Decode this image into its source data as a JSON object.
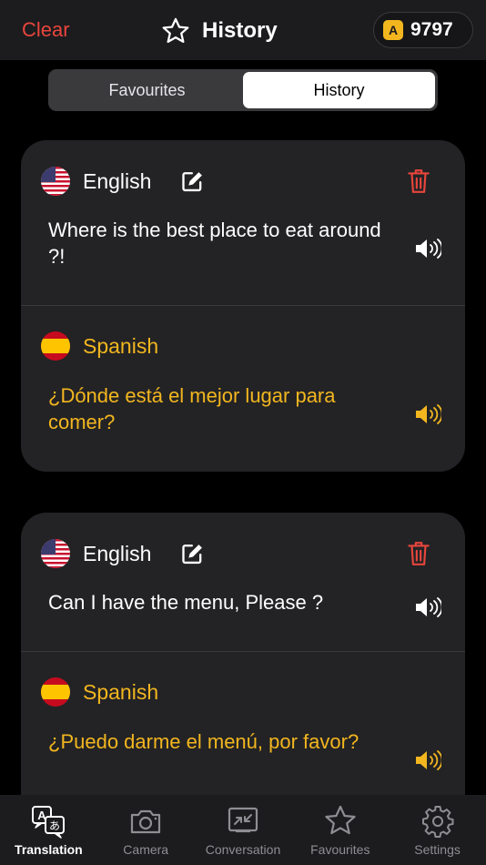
{
  "header": {
    "clear_label": "Clear",
    "title": "History",
    "coin_badge": "A",
    "coins": "9797"
  },
  "segment": {
    "options": [
      "Favourites",
      "History"
    ],
    "selected": "History"
  },
  "entries": [
    {
      "source_lang": "English",
      "source_text": "Where is the best place to eat around ?!",
      "target_lang": "Spanish",
      "target_text": "¿Dónde está el mejor lugar para comer?"
    },
    {
      "source_lang": "English",
      "source_text": "Can I have the menu, Please ?",
      "target_lang": "Spanish",
      "target_text": "¿Puedo darme el menú, por favor?"
    }
  ],
  "tabbar": {
    "tabs": [
      {
        "label": "Translation",
        "icon": "translation-icon",
        "active": true
      },
      {
        "label": "Camera",
        "icon": "camera-icon",
        "active": false
      },
      {
        "label": "Conversation",
        "icon": "conversation-icon",
        "active": false
      },
      {
        "label": "Favourites",
        "icon": "star-icon",
        "active": false
      },
      {
        "label": "Settings",
        "icon": "gear-icon",
        "active": false
      }
    ]
  },
  "colors": {
    "accent_yellow": "#f3b61f",
    "danger_red": "#e8453c",
    "card_bg": "#232325",
    "bar_bg": "#1c1c1e"
  }
}
